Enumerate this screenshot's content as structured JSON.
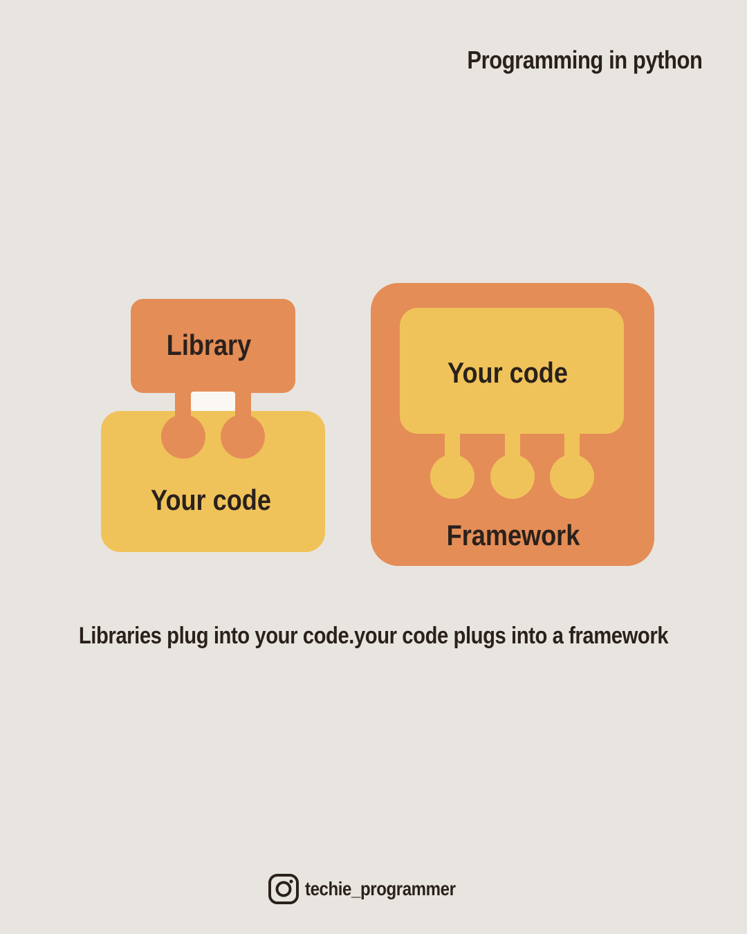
{
  "header": {
    "title": "Programming in python"
  },
  "library_diagram": {
    "library_label": "Library",
    "your_code_label": "Your code"
  },
  "framework_diagram": {
    "your_code_label": "Your code",
    "framework_label": "Framework"
  },
  "caption": "Libraries plug into your code.your code plugs into a framework",
  "footer": {
    "handle": "techie_programmer",
    "icon": "instagram-icon"
  },
  "colors": {
    "background": "#e8e5e0",
    "orange": "#e48d57",
    "yellow": "#f0c35a",
    "text": "#2a211c",
    "gap_white": "#fbf8f4"
  }
}
